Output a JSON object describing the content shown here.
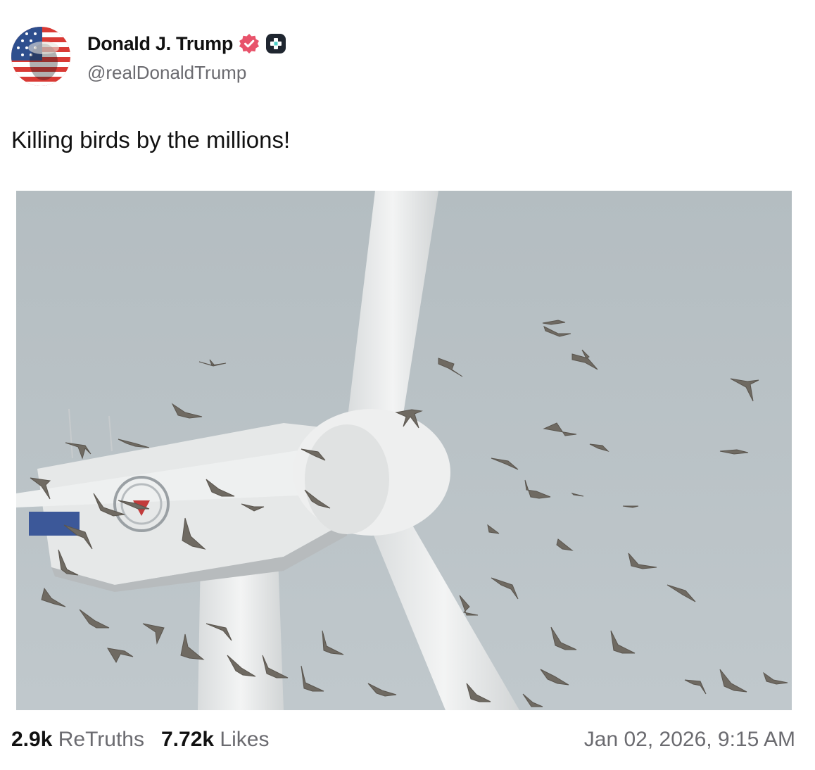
{
  "author": {
    "display_name": "Donald J. Trump",
    "handle": "@realDonaldTrump",
    "verified_icon": "verified-badge-icon",
    "extra_badge_icon": "plus-badge-icon",
    "verified_color": "#e8536b",
    "extra_badge_color": "#1f2630"
  },
  "post": {
    "text": "Killing birds by the millions!",
    "media_alt": ""
  },
  "stats": {
    "retruths_count": "2.9k",
    "retruths_label": "ReTruths",
    "likes_count": "7.72k",
    "likes_label": "Likes",
    "timestamp": "Jan 02, 2026, 9:15 AM"
  }
}
